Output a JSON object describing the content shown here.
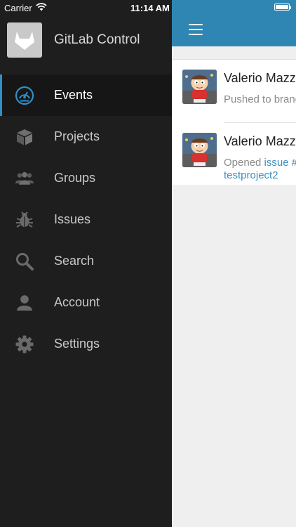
{
  "status_bar": {
    "carrier": "Carrier",
    "time": "11:14 AM"
  },
  "sidebar": {
    "app_title": "GitLab Control",
    "items": [
      {
        "label": "Events",
        "icon": "dashboard-gauge-icon",
        "active": true
      },
      {
        "label": "Projects",
        "icon": "box-icon",
        "active": false
      },
      {
        "label": "Groups",
        "icon": "group-icon",
        "active": false
      },
      {
        "label": "Issues",
        "icon": "bug-icon",
        "active": false
      },
      {
        "label": "Search",
        "icon": "search-icon",
        "active": false
      },
      {
        "label": "Account",
        "icon": "user-icon",
        "active": false
      },
      {
        "label": "Settings",
        "icon": "gear-icon",
        "active": false
      }
    ]
  },
  "main": {
    "events": [
      {
        "author": "Valerio Mazz",
        "description": "Pushed to branc"
      },
      {
        "author": "Valerio Mazz",
        "desc_prefix": "Opened ",
        "desc_link": "issue #",
        "desc_link2": "testproject2"
      }
    ]
  },
  "colors": {
    "accent": "#2f90c8",
    "navbar": "#2f86b3",
    "sidebar_bg": "#1e1e1e",
    "link": "#3b8fc4"
  }
}
